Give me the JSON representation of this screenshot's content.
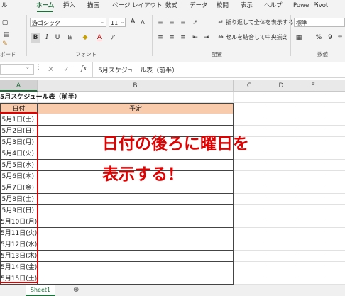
{
  "ribbon": {
    "tabs": [
      "ル",
      "ホーム",
      "挿入",
      "描画",
      "ページ レイアウト",
      "数式",
      "データ",
      "校閲",
      "表示",
      "ヘルプ",
      "Power Pivot"
    ],
    "font_name": "游ゴシック",
    "font_size": "11",
    "wrap_text": "折り返して全体を表示する",
    "merge_center": "セルを結合して中央揃え",
    "number_format": "標準",
    "group_clipboard": "ボード",
    "group_font": "フォント",
    "group_alignment": "配置",
    "group_number": "数値"
  },
  "formula_bar": {
    "name_box": "",
    "content": "5月スケジュール表（前半）"
  },
  "sheet": {
    "columns": [
      "A",
      "B",
      "C",
      "D",
      "E"
    ],
    "title": "5月スケジュール表（前半）",
    "header_date": "日付",
    "header_plan": "予定",
    "dates": [
      "5月1日(土)",
      "5月2日(日)",
      "5月3日(月)",
      "5月4日(火)",
      "5月5日(水)",
      "5月6日(木)",
      "5月7日(金)",
      "5月8日(土)",
      "5月9日(日)",
      "5月10日(月)",
      "5月11日(火)",
      "5月12日(水)",
      "5月13日(木)",
      "5月14日(金)",
      "5月15日(土)"
    ],
    "header_fill": "#f8cbad",
    "highlight_color": "#e00000"
  },
  "annotation": {
    "line1": "日付の後ろに曜日を",
    "line2": "表示する！",
    "color": "#e00000"
  },
  "sheet_tab": "Sheet1"
}
